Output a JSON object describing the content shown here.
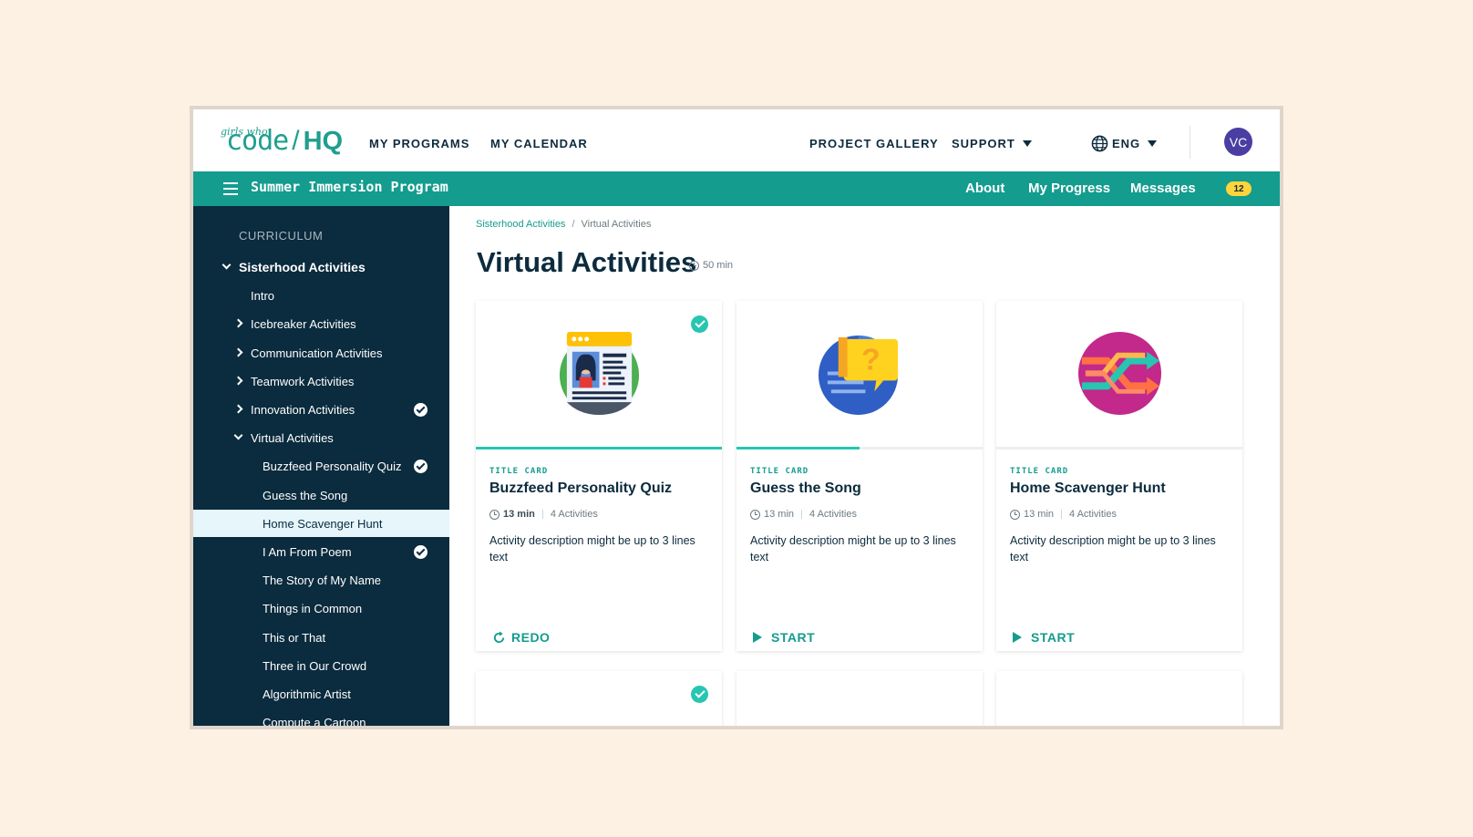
{
  "colors": {
    "teal": "#149c8e",
    "navy": "#0b2b3e",
    "accent_check": "#27c6b0",
    "badge": "#ffd43b",
    "avatar": "#4a3ea3"
  },
  "logo": {
    "small": "girls who",
    "main": "code",
    "slash": "/",
    "suffix": "HQ"
  },
  "topnav": {
    "left": [
      "MY PROGRAMS",
      "MY CALENDAR"
    ],
    "project_gallery": "PROJECT GALLERY",
    "support": "SUPPORT",
    "language": "ENG",
    "avatar_initials": "VC"
  },
  "programbar": {
    "title": "Summer Immersion Program",
    "links": [
      "About",
      "My Progress",
      "Messages"
    ],
    "messages_count": "12"
  },
  "sidebar": {
    "heading": "CURRICULUM",
    "items": [
      {
        "label": "Sisterhood Activities",
        "level": 0,
        "chevron": "down",
        "checked": false,
        "active": false
      },
      {
        "label": "Intro",
        "level": 1,
        "chevron": "",
        "checked": false,
        "active": false
      },
      {
        "label": "Icebreaker Activities",
        "level": 1,
        "chevron": "right",
        "checked": false,
        "active": false
      },
      {
        "label": "Communication Activities",
        "level": 1,
        "chevron": "right",
        "checked": false,
        "active": false
      },
      {
        "label": "Teamwork Activities",
        "level": 1,
        "chevron": "right",
        "checked": false,
        "active": false
      },
      {
        "label": "Innovation Activities",
        "level": 1,
        "chevron": "right",
        "checked": true,
        "active": false
      },
      {
        "label": "Virtual Activities",
        "level": 1,
        "chevron": "down",
        "checked": false,
        "active": false
      },
      {
        "label": "Buzzfeed Personality Quiz",
        "level": 2,
        "chevron": "",
        "checked": true,
        "active": false
      },
      {
        "label": "Guess the Song",
        "level": 2,
        "chevron": "",
        "checked": false,
        "active": false
      },
      {
        "label": "Home Scavenger Hunt",
        "level": 2,
        "chevron": "",
        "checked": false,
        "active": true
      },
      {
        "label": "I Am From Poem",
        "level": 2,
        "chevron": "",
        "checked": true,
        "active": false
      },
      {
        "label": "The Story of My Name",
        "level": 2,
        "chevron": "",
        "checked": false,
        "active": false
      },
      {
        "label": "Things in Common",
        "level": 2,
        "chevron": "",
        "checked": false,
        "active": false
      },
      {
        "label": "This or That",
        "level": 2,
        "chevron": "",
        "checked": false,
        "active": false
      },
      {
        "label": "Three in Our Crowd",
        "level": 2,
        "chevron": "",
        "checked": false,
        "active": false
      },
      {
        "label": "Algorithmic Artist",
        "level": 2,
        "chevron": "",
        "checked": false,
        "active": false
      },
      {
        "label": "Compute a Cartoon",
        "level": 2,
        "chevron": "",
        "checked": false,
        "active": false
      }
    ]
  },
  "main": {
    "breadcrumb": [
      "Sisterhood Activities",
      "Virtual Activities"
    ],
    "title": "Virtual Activities",
    "duration": "50 min",
    "cards": [
      {
        "type": "TITLE CARD",
        "title": "Buzzfeed Personality Quiz",
        "minutes": "13 min",
        "activities": "4 Activities",
        "description": "Activity description might be up to 3 lines text",
        "action": "REDO",
        "action_icon": "redo-icon",
        "progress": 1.0,
        "completed": true,
        "illustration": "profile-card-icon"
      },
      {
        "type": "TITLE CARD",
        "title": "Guess the Song",
        "minutes": "13 min",
        "activities": "4 Activities",
        "description": "Activity description might be up to 3 lines text",
        "action": "START",
        "action_icon": "play-icon",
        "progress": 0.5,
        "completed": false,
        "illustration": "question-bubble-icon"
      },
      {
        "type": "TITLE CARD",
        "title": "Home Scavenger Hunt",
        "minutes": "13 min",
        "activities": "4 Activities",
        "description": "Activity description might be up to 3 lines text",
        "action": "START",
        "action_icon": "play-icon",
        "progress": 0.0,
        "completed": false,
        "illustration": "shuffle-arrows-icon"
      }
    ],
    "second_row_completed": [
      true,
      false,
      false
    ]
  }
}
